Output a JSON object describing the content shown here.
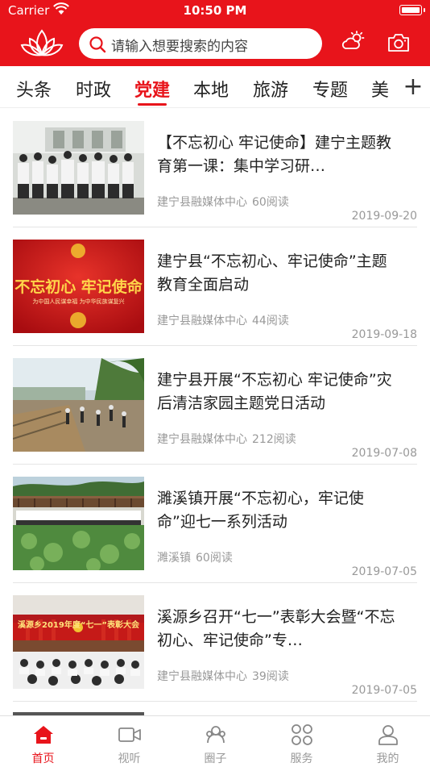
{
  "status_bar": {
    "carrier": "Carrier",
    "time": "10:50 PM"
  },
  "header": {
    "search_placeholder": "请输入想要搜索的内容",
    "colors": {
      "brand": "#e8141b"
    },
    "icons": [
      "lotus-logo",
      "search-icon",
      "weather-icon",
      "camera-icon"
    ]
  },
  "tabs": [
    {
      "label": "头条",
      "active": false
    },
    {
      "label": "时政",
      "active": false
    },
    {
      "label": "党建",
      "active": true
    },
    {
      "label": "本地",
      "active": false
    },
    {
      "label": "旅游",
      "active": false
    },
    {
      "label": "专题",
      "active": false
    },
    {
      "label": "美",
      "active": false
    }
  ],
  "tab_plus": "+",
  "articles": [
    {
      "title": "【不忘初心  牢记使命】建宁主题教育第一课：集中学习研…",
      "source": "建宁县融媒体中心",
      "reads": "60阅读",
      "date": "2019-09-20"
    },
    {
      "title": "建宁县“不忘初心、牢记使命”主题教育全面启动",
      "source": "建宁县融媒体中心",
      "reads": "44阅读",
      "date": "2019-09-18",
      "image_text": "不忘初心 牢记使命",
      "image_subtext": "为中国人民谋幸福 为中华民族谋复兴"
    },
    {
      "title": "建宁县开展“不忘初心 牢记使命”灾后清洁家园主题党日活动",
      "source": "建宁县融媒体中心",
      "reads": "212阅读",
      "date": "2019-07-08"
    },
    {
      "title": "濉溪镇开展“不忘初心，牢记使命”迎七一系列活动",
      "source": "濉溪镇",
      "reads": "60阅读",
      "date": "2019-07-05"
    },
    {
      "title": "溪源乡召开“七一”表彰大会暨“不忘初心、牢记使命”专…",
      "source": "建宁县融媒体中心",
      "reads": "39阅读",
      "date": "2019-07-05",
      "image_text": "溪源乡2019年度“七一”表彰大会"
    }
  ],
  "tabbar": [
    {
      "label": "首页",
      "icon": "home-icon",
      "active": true
    },
    {
      "label": "视听",
      "icon": "video-icon",
      "active": false
    },
    {
      "label": "圈子",
      "icon": "circle-icon",
      "active": false
    },
    {
      "label": "服务",
      "icon": "services-icon",
      "active": false
    },
    {
      "label": "我的",
      "icon": "profile-icon",
      "active": false
    }
  ]
}
